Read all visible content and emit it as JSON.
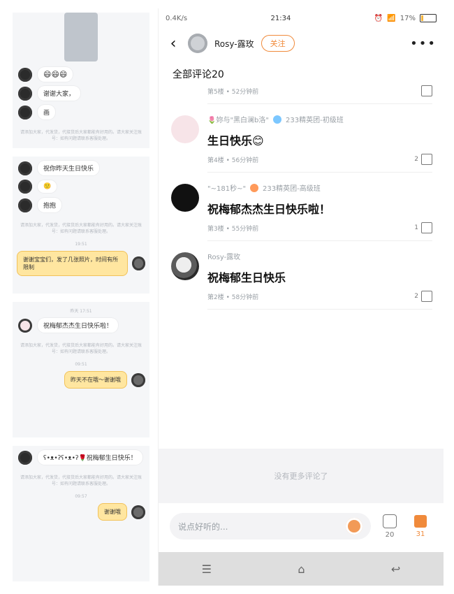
{
  "left_collage": {
    "panel1": {
      "emoji_text": "😄😄😄",
      "bubble_1": "谢谢大家，",
      "bubble_2": "画",
      "system_note": "请添加大家，代发货，代接货后大家都能有好用的。请大家关注账号：如有问题请联系客服处理。"
    },
    "panel2": {
      "bubble_1": "祝你昨天生日快乐",
      "bubble_2": "🙂",
      "bubble_3": "抱抱",
      "system_note": "请添加大家，代发货，代接货后大家都能有好用的。请大家关注账号：如有问题请联系客服处理。",
      "time": "19:51",
      "sticker": "谢谢宝宝们，发了几张照片，时间有所限制"
    },
    "panel3": {
      "time": "昨天 17:51",
      "bubble": "祝梅郁杰杰生日快乐啦！",
      "system_note": "请添加大家，代发货，代接货后大家都能有好用的。请大家关注账号：如有问题请联系客服处理。",
      "time2": "09:51",
      "sticker": "昨天不在哦～谢谢哦"
    },
    "panel4": {
      "bubble": "ʕ•ᴥ•ʔʕ•ᴥ•ʔ🌹祝梅郁生日快乐！",
      "system_note": "请添加大家，代发货，代接货后大家都能有好用的。请大家关注账号：如有问题请联系客服处理。",
      "time": "09:57",
      "sticker": "谢谢哦"
    }
  },
  "phone": {
    "status": {
      "speed": "0.4K/s",
      "time": "21:34",
      "battery": "17%",
      "battery_level": 0.17
    },
    "header": {
      "back_icon": "back-arrow",
      "username": "Rosy-露玫",
      "follow_label": "关注",
      "more_icon": "more-dots"
    },
    "section_title": "全部评论20",
    "partial_top_meta": "第5楼 • 52分钟前",
    "comments": [
      {
        "author": "🌷妳与\"黑白澜b洛\"",
        "group": "233精英团-初级班",
        "text": "生日快乐😊",
        "meta": "第4楼 • 56分钟前",
        "likes": "2"
      },
      {
        "author": "\"~181秒~\"",
        "group": "233精英团-高级班",
        "text": "祝梅郁杰杰生日快乐啦！",
        "meta": "第3楼 • 55分钟前",
        "likes": "1"
      },
      {
        "author": "Rosy-露玫",
        "group": "",
        "text": "祝梅郁生日快乐",
        "meta": "第2楼 • 58分钟前",
        "likes": "2"
      }
    ],
    "no_more_text": "没有更多评论了",
    "composer": {
      "placeholder": "说点好听的...",
      "comments_count": "20",
      "likes_count": "31"
    },
    "colors": {
      "accent": "#f08a3b",
      "navbar_bg": "#dedede"
    }
  }
}
